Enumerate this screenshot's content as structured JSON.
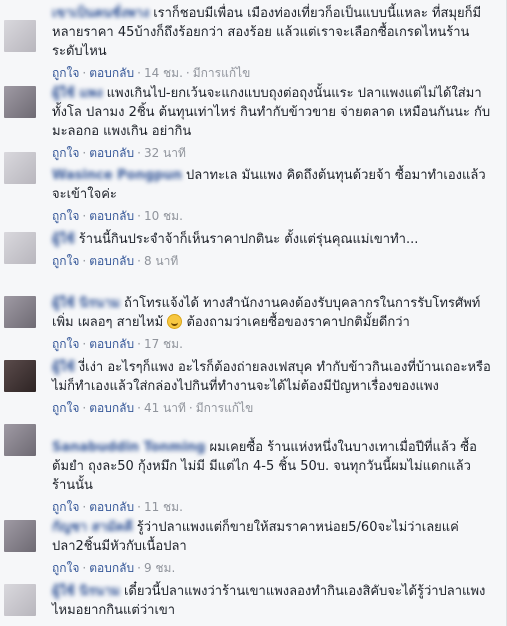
{
  "comments": [
    {
      "author": "เขาเป็นคนชั่งพาง",
      "text": "เราก็ชอบมีเพื่อน เมืองท่องเที่ยวก็อเป็นแบบนี้แหละ ที่สมุยก็มีหลายราคา 45บ้างก็ถึงร้อยกว่า สองร้อย แล้วแต่เราจะเลือกซื้อเกรดไหนร้านระดับไหน",
      "like": "ถูกใจ",
      "reply": "ตอบกลับ",
      "time": "14 ชม.",
      "edited": "มีการแก้ไข"
    },
    {
      "author": "ผู้ใช้ แพง",
      "text": "แพงเกินไป-ยกเว้นจะแกงแบบถุงต่อถุงนั้นแระ ปลาแพงแต่ไม่ได้ใส่มาทั้งโล ปลามง 2ชิ้น ต้นทุนเท่าไหร่ กินทำกับข้าวขาย จ่ายตลาด เหมือนกันนะ กับมะลอกอ แพงเกิน อย่ากิน",
      "like": "ถูกใจ",
      "reply": "ตอบกลับ",
      "time": "32 นาที",
      "edited": ""
    },
    {
      "author": "Wasince Pongpun",
      "text": "ปลาทะเล มันแพง คิดถึงต้นทุนด้วยจ้า ซื้อมาทำเองแล้วจะเข้าใจค่ะ",
      "like": "ถูกใจ",
      "reply": "ตอบกลับ",
      "time": "10 ชม.",
      "edited": ""
    },
    {
      "author": "ผู้ใช้",
      "text": "ร้านนี้กินประจำจ้าก็เห็นราคาปกตินะ ตั้งแต่รุ่นคุณแม่เขาทำ...",
      "like": "ถูกใจ",
      "reply": "ตอบกลับ",
      "time": "8 นาที",
      "edited": ""
    },
    {
      "author": "ผู้ใช้ นิรนาม",
      "text": "ถ้าโทรแจ้งได้ ทางสำนักงานคงต้องรับบุคลากรในการรับโทรศัพท์เพิ่ม เผลอๆ สายไหม้",
      "text_after": "ต้องถามว่าเคยซื้อของราคาปกติมั้ยดีกว่า",
      "like": "ถูกใจ",
      "reply": "ตอบกลับ",
      "time": "17 ชม.",
      "edited": ""
    },
    {
      "author": "ผู้ใช้",
      "text": "งี่เง่า อะไรๆก็แพง อะไรก็ต้องถ่ายลงเฟสบุค ทำกับข้าวกินเองที่บ้านเถอะหรือไม่ก็ทำเองแล้วใส่กล่องไปกินที่ทำงานจะได้ไม่ต้องมีปัญหาเรื่องของแพง",
      "like": "ถูกใจ",
      "reply": "ตอบกลับ",
      "time": "41 นาที",
      "edited": "มีการแก้ไข"
    },
    {
      "author": "Sanabuddin Tonming",
      "text": "ผมเคยซื้อ ร้านแห่งหนึ่งในบางเทาเมื่อปีที่แล้ว ซื้อต้มยำ ถุงละ50 กุ้งหมึก ไม่มี มีแต่ไก 4-5 ชิ้น 50บ. จนทุกวันนี้ผมไม่แดกแล้วร้านนั้น",
      "like": "ถูกใจ",
      "reply": "ตอบกลับ",
      "time": "11 ชม.",
      "edited": ""
    },
    {
      "author": "กัญชา สามัคคี",
      "text": "รู้ว่าปลาแพงแต่ก็ขายให้สมราคาหน่อย5/60จะไม่ว่าเลยแค่ปลา2ชิ้นมีหัวกับเนื้อปลา",
      "like": "ถูกใจ",
      "reply": "ตอบกลับ",
      "time": "9 ชม.",
      "edited": ""
    },
    {
      "author": "ผู้ใช้ นิรนาม",
      "text": "เดี๋ยวนี้ปลาแพงว่าร้านเขาแพงลองทำกินเองสิคับจะได้รู้ว่าปลาแพงไหมอยากกินแต่ว่าเขา",
      "like": "",
      "reply": "",
      "time": "",
      "edited": ""
    }
  ]
}
